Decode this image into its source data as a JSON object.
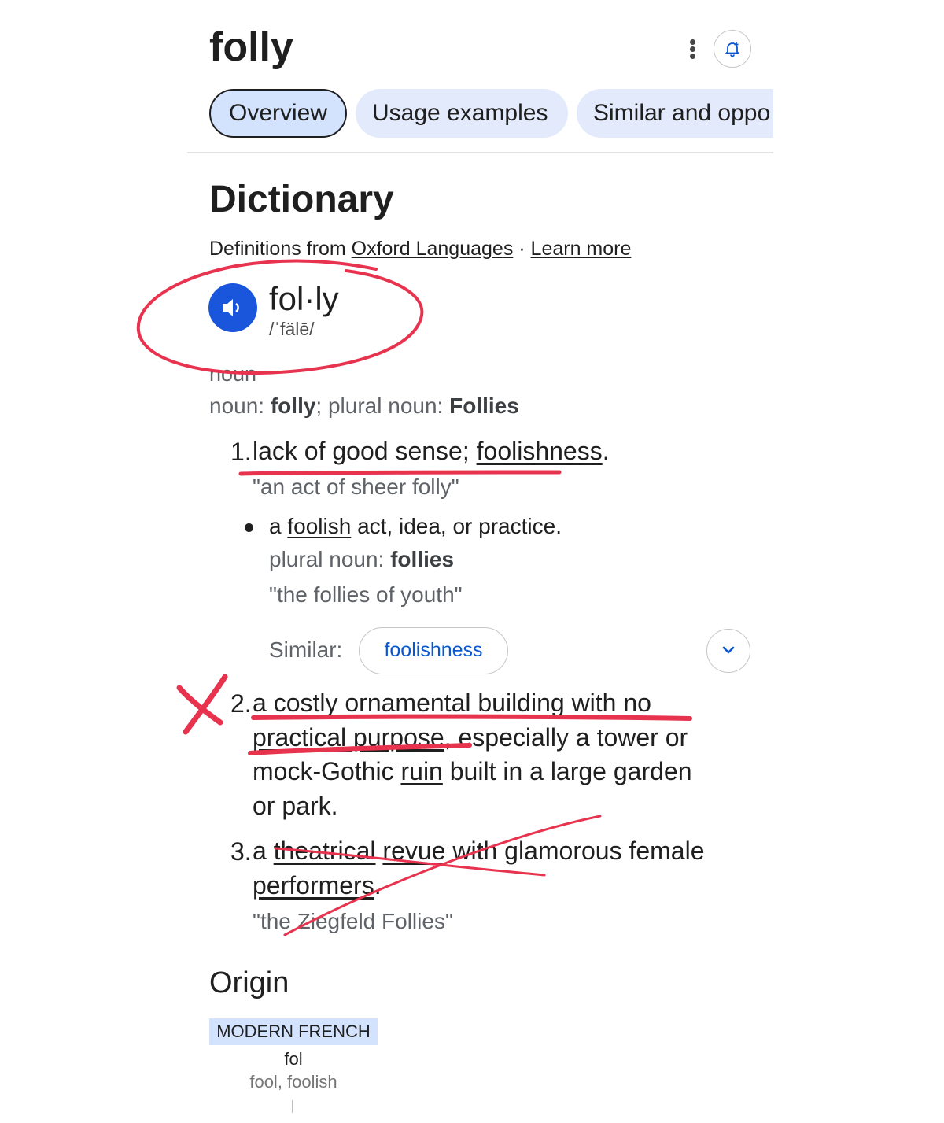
{
  "search": {
    "query": "folly"
  },
  "tabs": [
    {
      "label": "Overview",
      "active": true
    },
    {
      "label": "Usage examples",
      "active": false
    },
    {
      "label": "Similar and oppo",
      "active": false
    }
  ],
  "dictionary": {
    "heading": "Dictionary",
    "source_prefix": "Definitions from ",
    "source_link": "Oxford Languages",
    "separator": " · ",
    "learn_more": "Learn more",
    "headword": "fol·ly",
    "pronunciation": "/ˈfälē/",
    "part_of_speech": "noun",
    "forms": {
      "label1": "noun: ",
      "value1": "folly",
      "label2": "; plural noun: ",
      "value2": "Follies"
    },
    "senses": [
      {
        "number": "1.",
        "text_a": "lack of good sense; ",
        "link": "foolishness",
        "text_b": ".",
        "example": "\"an act of sheer folly\"",
        "subsense": {
          "text_a": "a ",
          "link": "foolish",
          "text_b": " act, idea, or practice.",
          "plural_label": "plural noun: ",
          "plural_value": "follies",
          "example": "\"the follies of youth\""
        },
        "similar_label": "Similar:",
        "similar_chip": "foolishness"
      },
      {
        "number": "2.",
        "line1_a": "a costly ",
        "line1_link": "ornamental",
        "line1_b": " building with no",
        "line2_link": "practical purpose",
        "line2_b": ", especially a tower or",
        "line3_a": "mock-Gothic ",
        "line3_link": "ruin",
        "line3_b": " built in a large garden",
        "line4": "or park."
      },
      {
        "number": "3.",
        "line1_a": "a ",
        "line1_link1": "theatrical",
        "line1_space": " ",
        "line1_link2": "revue",
        "line1_b": " with glamorous female",
        "line2_link": "performers",
        "line2_b": ".",
        "example": "\"the Ziegfeld Follies\""
      }
    ]
  },
  "origin": {
    "heading": "Origin",
    "language": "MODERN FRENCH",
    "word": "fol",
    "gloss": "fool, foolish"
  },
  "colors": {
    "annotation": "#e8334f",
    "accent": "#0b57d0",
    "speaker": "#1a56db",
    "tab_bg": "#e3eafc"
  }
}
